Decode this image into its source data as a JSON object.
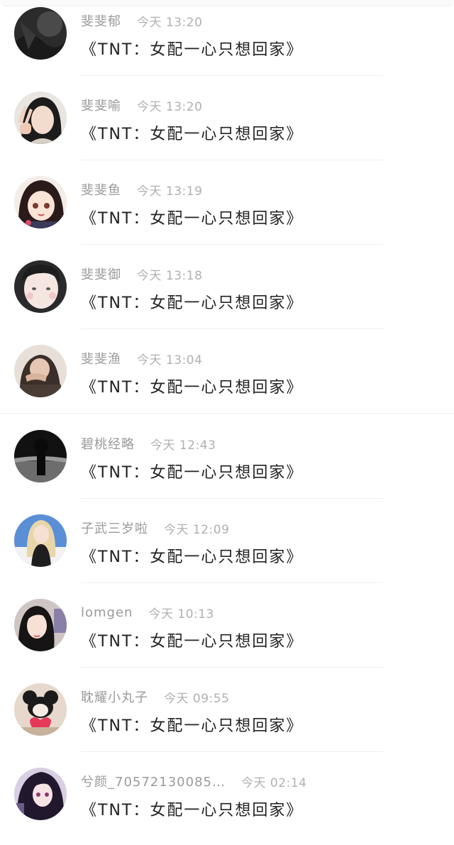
{
  "comments": [
    {
      "nickname": "斐斐郁",
      "time": "今天 13:20",
      "text": "《TNT：女配一心只想回家》",
      "avatar_icon": "dark-photo-avatar"
    },
    {
      "nickname": "斐斐喻",
      "time": "今天 13:20",
      "text": "《TNT：女配一心只想回家》",
      "avatar_icon": "girl-peace-sign-avatar"
    },
    {
      "nickname": "斐斐鱼",
      "time": "今天 13:19",
      "text": "《TNT：女配一心只想回家》",
      "avatar_icon": "anime-girl-avatar"
    },
    {
      "nickname": "斐斐御",
      "time": "今天 13:18",
      "text": "《TNT：女配一心只想回家》",
      "avatar_icon": "pale-face-avatar"
    },
    {
      "nickname": "斐斐渔",
      "time": "今天 13:04",
      "text": "《TNT：女配一心只想回家》",
      "avatar_icon": "girl-hoodie-avatar"
    },
    {
      "nickname": "碧桃经略",
      "time": "今天 12:43",
      "text": "《TNT：女配一心只想回家》",
      "avatar_icon": "silhouette-avatar"
    },
    {
      "nickname": "子武三岁啦",
      "time": "今天 12:09",
      "text": "《TNT：女配一心只想回家》",
      "avatar_icon": "blonde-girl-avatar"
    },
    {
      "nickname": "lomgen",
      "time": "今天 10:13",
      "text": "《TNT：女配一心只想回家》",
      "avatar_icon": "dark-hair-girl-avatar"
    },
    {
      "nickname": "耽耀小丸子",
      "time": "今天 09:55",
      "text": "《TNT：女配一心只想回家》",
      "avatar_icon": "plush-toy-avatar"
    },
    {
      "nickname": "兮颜_70572130085…",
      "time": "今天 02:14",
      "text": "《TNT：女配一心只想回家》",
      "avatar_icon": "anime-dark-avatar"
    }
  ],
  "colors": {
    "nickname": "#9a9a9a",
    "time": "#b0b0b0",
    "content": "#222222",
    "divider": "#eeeeee"
  }
}
